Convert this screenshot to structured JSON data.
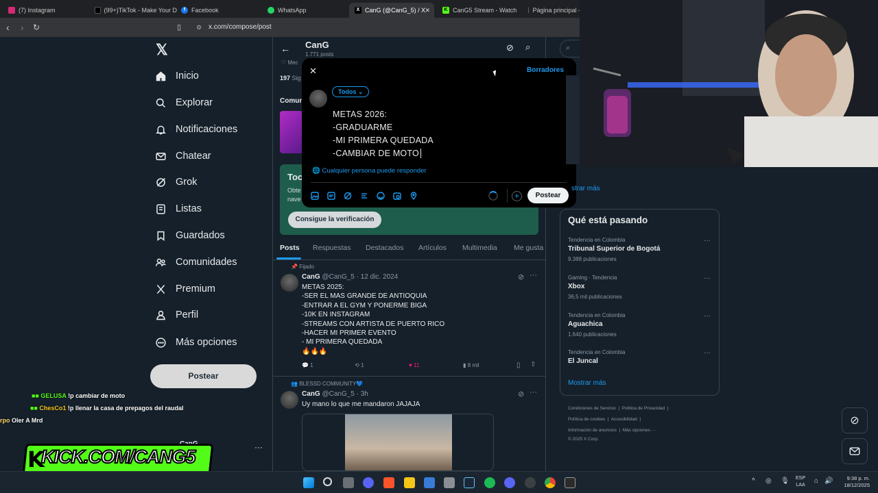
{
  "browser": {
    "tabs": [
      {
        "label": "(7) Instagram",
        "icon": "instagram-icon",
        "color": "#d62976"
      },
      {
        "label": "(99+)TikTok - Make Your D",
        "icon": "tiktok-icon",
        "color": "#000000"
      },
      {
        "label": "Facebook",
        "icon": "facebook-icon",
        "color": "#1877f2"
      },
      {
        "label": "WhatsApp",
        "icon": "whatsapp-icon",
        "color": "#25d366"
      },
      {
        "label": "CanG (@CanG_5) / X",
        "icon": "x-icon",
        "color": "#000000"
      },
      {
        "label": "CanG5 Stream - Watch",
        "icon": "kick-icon",
        "color": "#53fc18"
      },
      {
        "label": "Página principal -",
        "icon": "globe-icon",
        "color": "#5f6368"
      }
    ],
    "url": "x.com/compose/post"
  },
  "sidebar": {
    "items": [
      {
        "label": "Inicio",
        "icon": "home-icon"
      },
      {
        "label": "Explorar",
        "icon": "search-icon"
      },
      {
        "label": "Notificaciones",
        "icon": "bell-icon"
      },
      {
        "label": "Chatear",
        "icon": "mail-icon"
      },
      {
        "label": "Grok",
        "icon": "grok-icon"
      },
      {
        "label": "Listas",
        "icon": "list-icon"
      },
      {
        "label": "Guardados",
        "icon": "bookmark-icon"
      },
      {
        "label": "Comunidades",
        "icon": "communities-icon"
      },
      {
        "label": "Premium",
        "icon": "x-logo-icon"
      },
      {
        "label": "Perfil",
        "icon": "user-icon"
      },
      {
        "label": "Más opciones",
        "icon": "more-circle-icon"
      }
    ],
    "post_label": "Postear",
    "account_name": "CanG"
  },
  "profile": {
    "name": "CanG",
    "posts_count": "1.771 posts",
    "following_fragment": "197",
    "following_word": "Sig",
    "meta_fragment": "Mec",
    "communities_fragment": "Comun",
    "verify_title_fragment": "Toc",
    "verify_text1": "Obte",
    "verify_text2": "nave",
    "verify_button": "Consigue la verificación",
    "tabs": [
      "Posts",
      "Respuestas",
      "Destacados",
      "Artículos",
      "Multimedia",
      "Me gusta"
    ]
  },
  "tweets": [
    {
      "pinned": "Fijado",
      "name": "CanG",
      "handle": "@CanG_5 · 12 dic. 2024",
      "lines": [
        "METAS 2025:",
        "-SER EL MAS GRANDE DE ANTIOQUIA",
        "-ENTRAR A EL GYM Y PONERME BIGA",
        "-10K EN INSTAGRAM",
        "-STREAMS CON ARTISTA DE PUERTO RICO",
        "-HACER MI PRIMER EVENTO",
        "- MI PRIMERA QUEDADA",
        "🔥🔥🔥"
      ],
      "replies": "1",
      "reposts": "1",
      "likes": "11",
      "views": "8 mil"
    },
    {
      "community": "BLESSD COMMUNITY💙",
      "name": "CanG",
      "handle": "@CanG_5 · 3h",
      "text": "Uy mano lo que me mandaron JAJAJA"
    }
  ],
  "compose": {
    "drafts": "Borradores",
    "audience": "Todos",
    "lines": [
      "METAS 2026:",
      "-GRADUARME",
      "-MI PRIMERA QUEDADA",
      "-CAMBIAR DE MOTO"
    ],
    "reply_setting": "Cualquier persona puede responder",
    "post_label": "Postear"
  },
  "right": {
    "show_more_top": "strar más",
    "section_title": "Qué está pasando",
    "trends": [
      {
        "category": "Tendencia en Colombia",
        "name": "Tribunal Superior de Bogotá",
        "count": "9.388 publicaciones"
      },
      {
        "category": "Gaming · Tendencia",
        "name": "Xbox",
        "count": "36,5 mil publicaciones"
      },
      {
        "category": "Tendencia en Colombia",
        "name": "Aguachica",
        "count": "1.640 publicaciones"
      },
      {
        "category": "Tendencia en Colombia",
        "name": "El Juncal",
        "count": ""
      }
    ],
    "show_more": "Mostrar más",
    "footer": [
      [
        "Condiciones de Servicio",
        "Política de Privacidad"
      ],
      [
        "Política de cookies",
        "Accesibilidad"
      ],
      [
        "Información de anuncios",
        "Más opciones ···"
      ],
      [
        "© 2025 X Corp."
      ]
    ]
  },
  "chat": [
    {
      "user": "GELUSA",
      "message": "!p cambiar de moto",
      "color": "#53fc18"
    },
    {
      "user": "ChesCo1",
      "message": "!p llenar la casa de prepagos del raudal",
      "color": "#f5c518"
    },
    {
      "user": "rpo",
      "message": "Oler A Mrd",
      "color": "#ffd966"
    }
  ],
  "overlay": {
    "kick_text": "KICK.COM/CANG5",
    "kick_letter": "K"
  },
  "taskbar": {
    "lang1": "ESP",
    "lang2": "LAA",
    "time": "9:38 p. m.",
    "date": "18/12/2025"
  }
}
